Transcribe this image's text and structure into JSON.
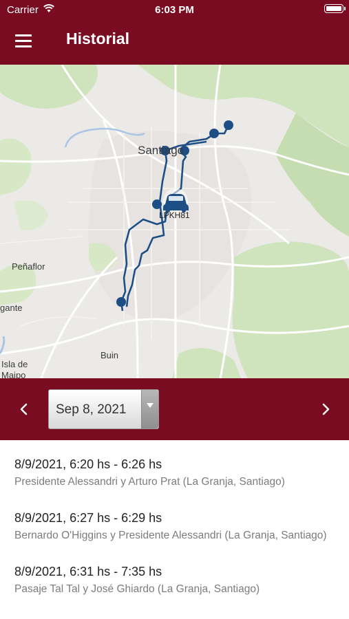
{
  "status_bar": {
    "carrier": "Carrier",
    "time": "6:03 PM"
  },
  "header": {
    "title": "Historial"
  },
  "map": {
    "labels": {
      "city": "Santiago",
      "vehicle": "LPKH81",
      "place_1": "Peñaflor",
      "place_2": "gante",
      "place_3": "Buin",
      "place_4": "Isla de",
      "place_5": "Maipo"
    },
    "route_color": "#1d4f86"
  },
  "date_selector": {
    "selected_date": "Sep 8, 2021"
  },
  "trips": [
    {
      "time": "8/9/2021, 6:20 hs - 6:26 hs",
      "address": "Presidente Alessandri y Arturo Prat (La Granja, Santiago)"
    },
    {
      "time": "8/9/2021, 6:27 hs - 6:29 hs",
      "address": "Bernardo O'Higgins y Presidente Alessandri (La Granja, Santiago)"
    },
    {
      "time": "8/9/2021, 6:31 hs - 7:35 hs",
      "address": "Pasaje Tal Tal y José Ghiardo (La Granja, Santiago)"
    }
  ],
  "colors": {
    "brand": "#7a0c22",
    "route": "#1d4f86"
  }
}
